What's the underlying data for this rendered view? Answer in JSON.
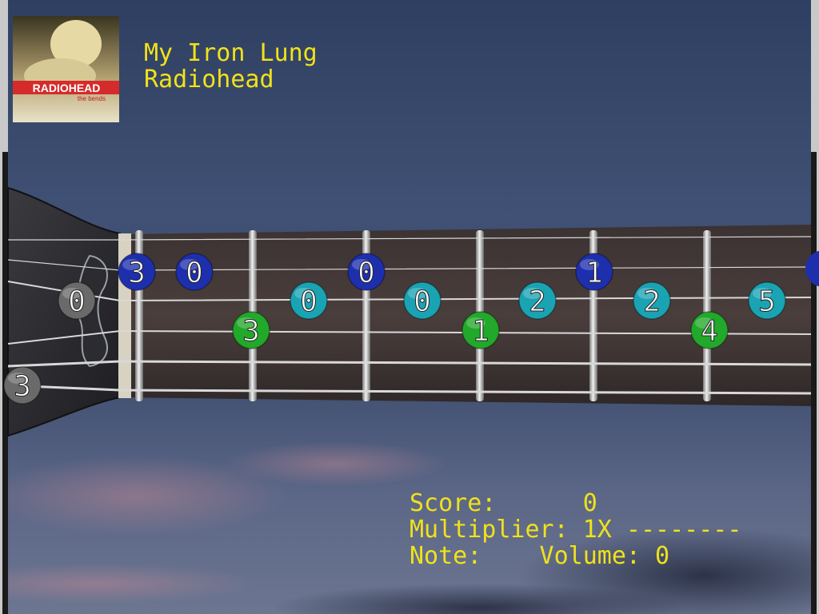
{
  "song": {
    "title": "My Iron Lung",
    "artist": "Radiohead",
    "album_art": {
      "band_text": "RADIOHEAD",
      "album_text": "the bends"
    }
  },
  "hud": {
    "score_line": "Score:      0",
    "multiplier_line": "Multiplier: 1X --------",
    "note_line": "Note:    Volume: 0"
  },
  "fretboard": {
    "notes": [
      {
        "label": "0",
        "color": "gray",
        "string": 3,
        "slot": "nut-left"
      },
      {
        "label": "3",
        "color": "gray",
        "string": 6,
        "slot": "offscreen-left"
      },
      {
        "label": "3",
        "color": "blue",
        "string": 2,
        "fret": 1
      },
      {
        "label": "0",
        "color": "blue",
        "string": 2,
        "fret": 1.5
      },
      {
        "label": "0",
        "color": "blue",
        "string": 2,
        "fret": 3
      },
      {
        "label": "1",
        "color": "blue",
        "string": 2,
        "fret": 5
      },
      {
        "label": "3",
        "color": "green",
        "string": 4,
        "fret": 1.8
      },
      {
        "label": "0",
        "color": "teal",
        "string": 3,
        "fret": 2.5
      },
      {
        "label": "0",
        "color": "teal",
        "string": 3,
        "fret": 3.5
      },
      {
        "label": "1",
        "color": "green",
        "string": 4,
        "fret": 4
      },
      {
        "label": "2",
        "color": "teal",
        "string": 3,
        "fret": 4.5
      },
      {
        "label": "2",
        "color": "teal",
        "string": 3,
        "fret": 5.5
      },
      {
        "label": "4",
        "color": "green",
        "string": 4,
        "fret": 6
      },
      {
        "label": "5",
        "color": "teal",
        "string": 3,
        "fret": 6.5
      }
    ],
    "colors": {
      "blue": "#1e2fae",
      "teal": "#1aa3b3",
      "green": "#22a82a",
      "gray": "#6a6a6a",
      "text": "#f0e21a"
    }
  }
}
